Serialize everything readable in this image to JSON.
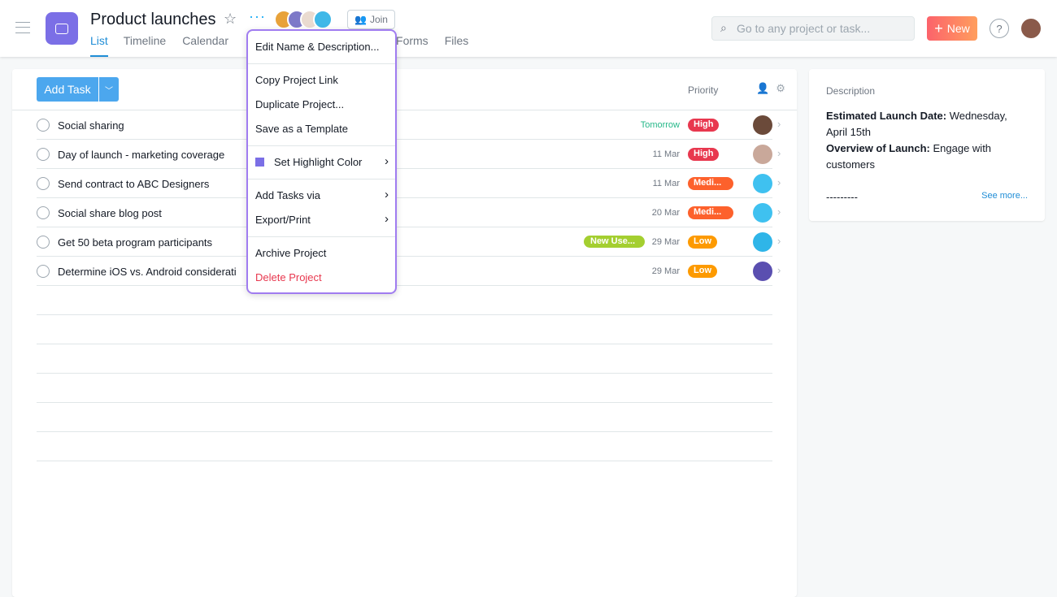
{
  "header": {
    "title": "Product launches",
    "join_label": "Join",
    "search_placeholder": "Go to any project or task...",
    "new_label": "New",
    "help_label": "?",
    "tabs": [
      {
        "label": "List"
      },
      {
        "label": "Timeline"
      },
      {
        "label": "Calendar"
      },
      {
        "label": "Forms"
      },
      {
        "label": "Files"
      }
    ],
    "member_colors": [
      "#e8a23a",
      "#7d79c8",
      "#eadbd0",
      "#3fb8e8"
    ]
  },
  "toolbar": {
    "add_task_label": "Add Task",
    "priority_header": "Priority"
  },
  "tasks": [
    {
      "name": "Social sharing",
      "tag": "",
      "due": "Tomorrow",
      "due_color": "#25b889",
      "priority": "High",
      "priority_color": "#e8384f",
      "assignee_color": "#6b4a3a"
    },
    {
      "name": "Day of launch - marketing coverage",
      "tag": "",
      "due": "11 Mar",
      "due_color": "#6f7782",
      "priority": "High",
      "priority_color": "#e8384f",
      "assignee_color": "#c9a89a"
    },
    {
      "name": "Send contract to ABC Designers",
      "tag": "",
      "due": "11 Mar",
      "due_color": "#6f7782",
      "priority": "Medi...",
      "priority_color": "#fd612c",
      "assignee_color": "#3fc1f0"
    },
    {
      "name": "Social share blog post",
      "tag": "",
      "due": "20 Mar",
      "due_color": "#6f7782",
      "priority": "Medi...",
      "priority_color": "#fd612c",
      "assignee_color": "#3fc1f0"
    },
    {
      "name": "Get 50 beta program participants",
      "tag": "New Use...",
      "due": "29 Mar",
      "due_color": "#6f7782",
      "priority": "Low",
      "priority_color": "#fd9a00",
      "assignee_color": "#2fb5e8"
    },
    {
      "name": "Determine iOS vs. Android considerati",
      "tag": "",
      "due": "29 Mar",
      "due_color": "#6f7782",
      "priority": "Low",
      "priority_color": "#fd9a00",
      "assignee_color": "#5a4fb0"
    }
  ],
  "description": {
    "heading": "Description",
    "date_label": "Estimated Launch Date:",
    "date_value": " Wednesday, April 15th",
    "overview_label": "Overview of Launch:",
    "overview_value": " Engage with customers",
    "divider_text": "---------",
    "see_more": "See more..."
  },
  "menu": {
    "items": [
      "Edit Name & Description...",
      "Copy Project Link",
      "Duplicate Project...",
      "Save as a Template",
      "Set Highlight Color",
      "Add Tasks via",
      "Export/Print",
      "Archive Project",
      "Delete Project"
    ],
    "highlight_color": "#7b6fe6",
    "delete_color": "#e8384f"
  }
}
